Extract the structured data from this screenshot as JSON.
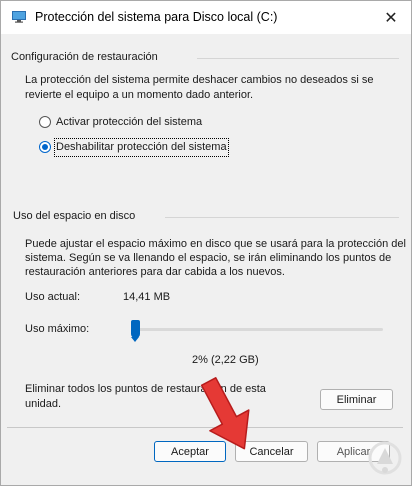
{
  "window": {
    "title": "Protección del sistema para Disco local (C:)",
    "close_glyph": "✕"
  },
  "restore_settings": {
    "group_label": "Configuración de restauración",
    "description_line1": "La protección del sistema permite deshacer cambios no deseados si se",
    "description_line2": "revierte el equipo a un momento dado anterior.",
    "options": [
      {
        "label": "Activar protección del sistema",
        "selected": false
      },
      {
        "label": "Deshabilitar protección del sistema",
        "selected": true
      }
    ]
  },
  "disk_usage": {
    "group_label": "Uso del espacio en disco",
    "description_line1": "Puede ajustar el espacio máximo en disco que se usará para la protección del",
    "description_line2": "sistema. Según se va llenando el espacio, se irán eliminando los puntos de",
    "description_line3": "restauración anteriores para dar cabida a los nuevos.",
    "current_usage_label": "Uso actual:",
    "current_usage_value": "14,41 MB",
    "max_usage_label": "Uso máximo:",
    "max_usage_fraction": 0.02,
    "max_usage_readout": "2% (2,22 GB)",
    "delete_text_line1": "Eliminar todos los puntos de restauración de esta",
    "delete_text_line2": "unidad.",
    "delete_button": "Eliminar"
  },
  "footer": {
    "ok_button": "Aceptar",
    "cancel_button": "Cancelar",
    "apply_button": "Aplicar"
  },
  "colors": {
    "accent": "#0067c0",
    "arrow": "#e53935"
  },
  "icons": {
    "title_icon": "computer-icon",
    "close_icon": "close-icon",
    "overlay_arrow": "red-arrow-icon",
    "watermark": "watermark-logo"
  }
}
